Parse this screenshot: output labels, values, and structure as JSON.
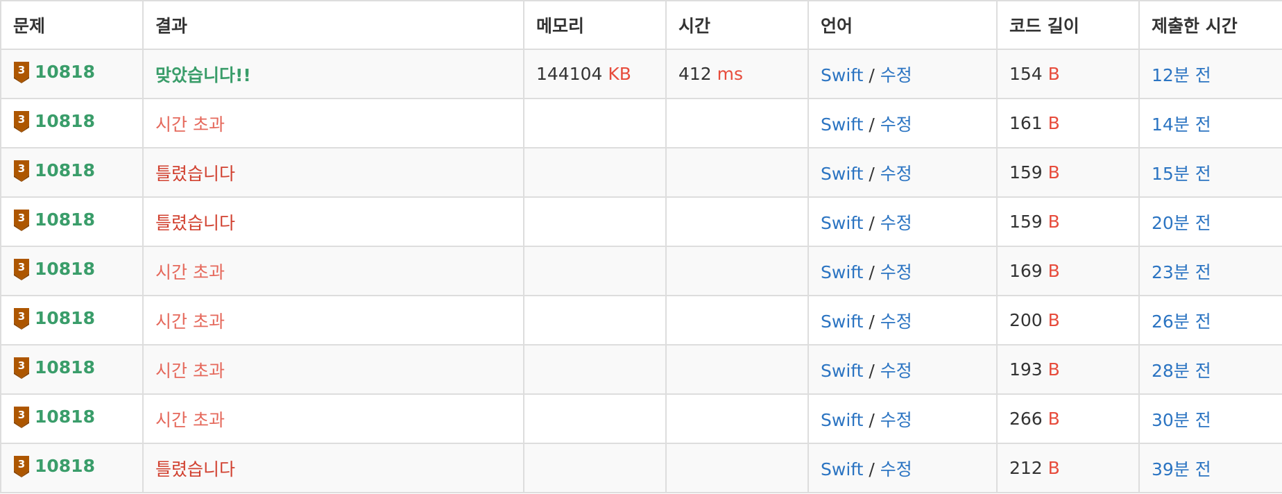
{
  "table": {
    "headers": [
      "문제",
      "결과",
      "메모리",
      "시간",
      "언어",
      "코드 길이",
      "제출한 시간"
    ],
    "rows": [
      {
        "problem_id": "10818",
        "tier_label": "3",
        "result": "맞았습니다!!",
        "result_type": "ac",
        "memory": "144104",
        "memory_unit": "KB",
        "time": "412",
        "time_unit": "ms",
        "language": "Swift",
        "separator": "/",
        "edit": "수정",
        "code_length": "154",
        "code_unit": "B",
        "submitted": "12분 전"
      },
      {
        "problem_id": "10818",
        "tier_label": "3",
        "result": "시간 초과",
        "result_type": "tle",
        "memory": "",
        "memory_unit": "",
        "time": "",
        "time_unit": "",
        "language": "Swift",
        "separator": "/",
        "edit": "수정",
        "code_length": "161",
        "code_unit": "B",
        "submitted": "14분 전"
      },
      {
        "problem_id": "10818",
        "tier_label": "3",
        "result": "틀렸습니다",
        "result_type": "wa",
        "memory": "",
        "memory_unit": "",
        "time": "",
        "time_unit": "",
        "language": "Swift",
        "separator": "/",
        "edit": "수정",
        "code_length": "159",
        "code_unit": "B",
        "submitted": "15분 전"
      },
      {
        "problem_id": "10818",
        "tier_label": "3",
        "result": "틀렸습니다",
        "result_type": "wa",
        "memory": "",
        "memory_unit": "",
        "time": "",
        "time_unit": "",
        "language": "Swift",
        "separator": "/",
        "edit": "수정",
        "code_length": "159",
        "code_unit": "B",
        "submitted": "20분 전"
      },
      {
        "problem_id": "10818",
        "tier_label": "3",
        "result": "시간 초과",
        "result_type": "tle",
        "memory": "",
        "memory_unit": "",
        "time": "",
        "time_unit": "",
        "language": "Swift",
        "separator": "/",
        "edit": "수정",
        "code_length": "169",
        "code_unit": "B",
        "submitted": "23분 전"
      },
      {
        "problem_id": "10818",
        "tier_label": "3",
        "result": "시간 초과",
        "result_type": "tle",
        "memory": "",
        "memory_unit": "",
        "time": "",
        "time_unit": "",
        "language": "Swift",
        "separator": "/",
        "edit": "수정",
        "code_length": "200",
        "code_unit": "B",
        "submitted": "26분 전"
      },
      {
        "problem_id": "10818",
        "tier_label": "3",
        "result": "시간 초과",
        "result_type": "tle",
        "memory": "",
        "memory_unit": "",
        "time": "",
        "time_unit": "",
        "language": "Swift",
        "separator": "/",
        "edit": "수정",
        "code_length": "193",
        "code_unit": "B",
        "submitted": "28분 전"
      },
      {
        "problem_id": "10818",
        "tier_label": "3",
        "result": "시간 초과",
        "result_type": "tle",
        "memory": "",
        "memory_unit": "",
        "time": "",
        "time_unit": "",
        "language": "Swift",
        "separator": "/",
        "edit": "수정",
        "code_length": "266",
        "code_unit": "B",
        "submitted": "30분 전"
      },
      {
        "problem_id": "10818",
        "tier_label": "3",
        "result": "틀렸습니다",
        "result_type": "wa",
        "memory": "",
        "memory_unit": "",
        "time": "",
        "time_unit": "",
        "language": "Swift",
        "separator": "/",
        "edit": "수정",
        "code_length": "212",
        "code_unit": "B",
        "submitted": "39분 전"
      }
    ]
  },
  "colors": {
    "accepted": "#3a9d6a",
    "time_limit": "#e5685b",
    "wrong": "#d1402f",
    "unit": "#e74c3c",
    "link": "#2b74c2",
    "bronze_badge": "#ad5600"
  },
  "icons": {
    "tier_badge": "bronze-tier-3-icon"
  }
}
